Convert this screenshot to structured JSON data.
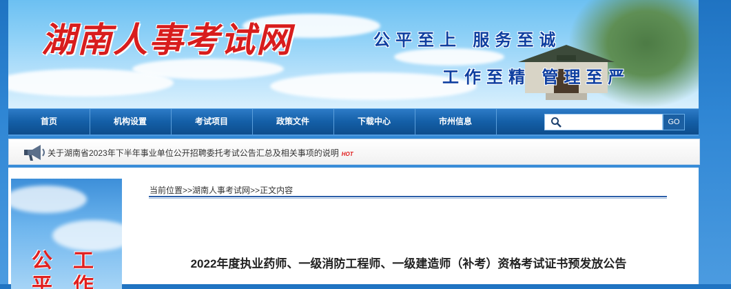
{
  "header": {
    "site_title": "湖南人事考试网",
    "slogan_1": "公平至上 服务至诚",
    "slogan_2": "工作至精 管理至严"
  },
  "nav": {
    "items": [
      {
        "label": "首页"
      },
      {
        "label": "机构设置"
      },
      {
        "label": "考试项目"
      },
      {
        "label": "政策文件"
      },
      {
        "label": "下载中心"
      },
      {
        "label": "市州信息"
      }
    ],
    "search": {
      "value": "",
      "placeholder": ""
    },
    "go_label": "GO"
  },
  "notice": {
    "text": "关于湖南省2023年下半年事业单位公开招聘委托考试公告汇总及相关事项的说明",
    "badge": "HOT"
  },
  "sidebar": {
    "chars": [
      "公",
      "工",
      "平",
      "作"
    ]
  },
  "breadcrumb": {
    "label": "当前位置",
    "sep": ">>",
    "home": "湖南人事考试网",
    "current": "正文内容"
  },
  "article": {
    "title": "2022年度执业药师、一级消防工程师、一级建造师（补考）资格考试证书预发放公告"
  },
  "colors": {
    "nav_dark": "#0d4d8c",
    "title_red": "#d81d1d",
    "slogan_blue": "#0f3fa0",
    "hot_red": "#e01a1a"
  },
  "icons": [
    "search-icon",
    "megaphone-icon"
  ]
}
